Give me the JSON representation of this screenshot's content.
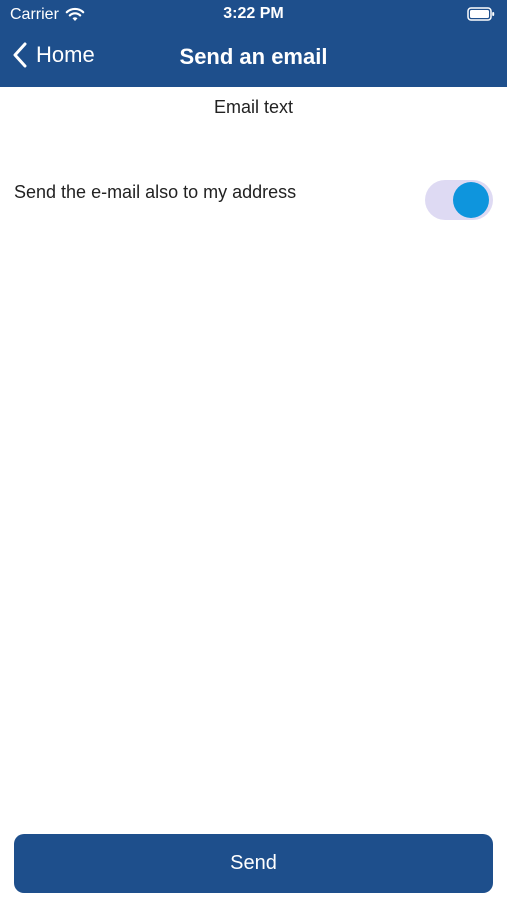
{
  "status_bar": {
    "carrier": "Carrier",
    "time": "3:22 PM",
    "icons": [
      "wifi-icon",
      "battery-icon"
    ]
  },
  "nav": {
    "back_label": "Home",
    "title": "Send an email",
    "back_icon": "chevron-left-icon"
  },
  "content": {
    "email_text_label": "Email text",
    "copy_toggle": {
      "label": "Send the e-mail also to my address",
      "on": true
    }
  },
  "footer": {
    "send_label": "Send"
  },
  "colors": {
    "brand": "#1e4f8c",
    "toggle_track": "#dedaf3",
    "toggle_knob": "#0e95dd"
  }
}
